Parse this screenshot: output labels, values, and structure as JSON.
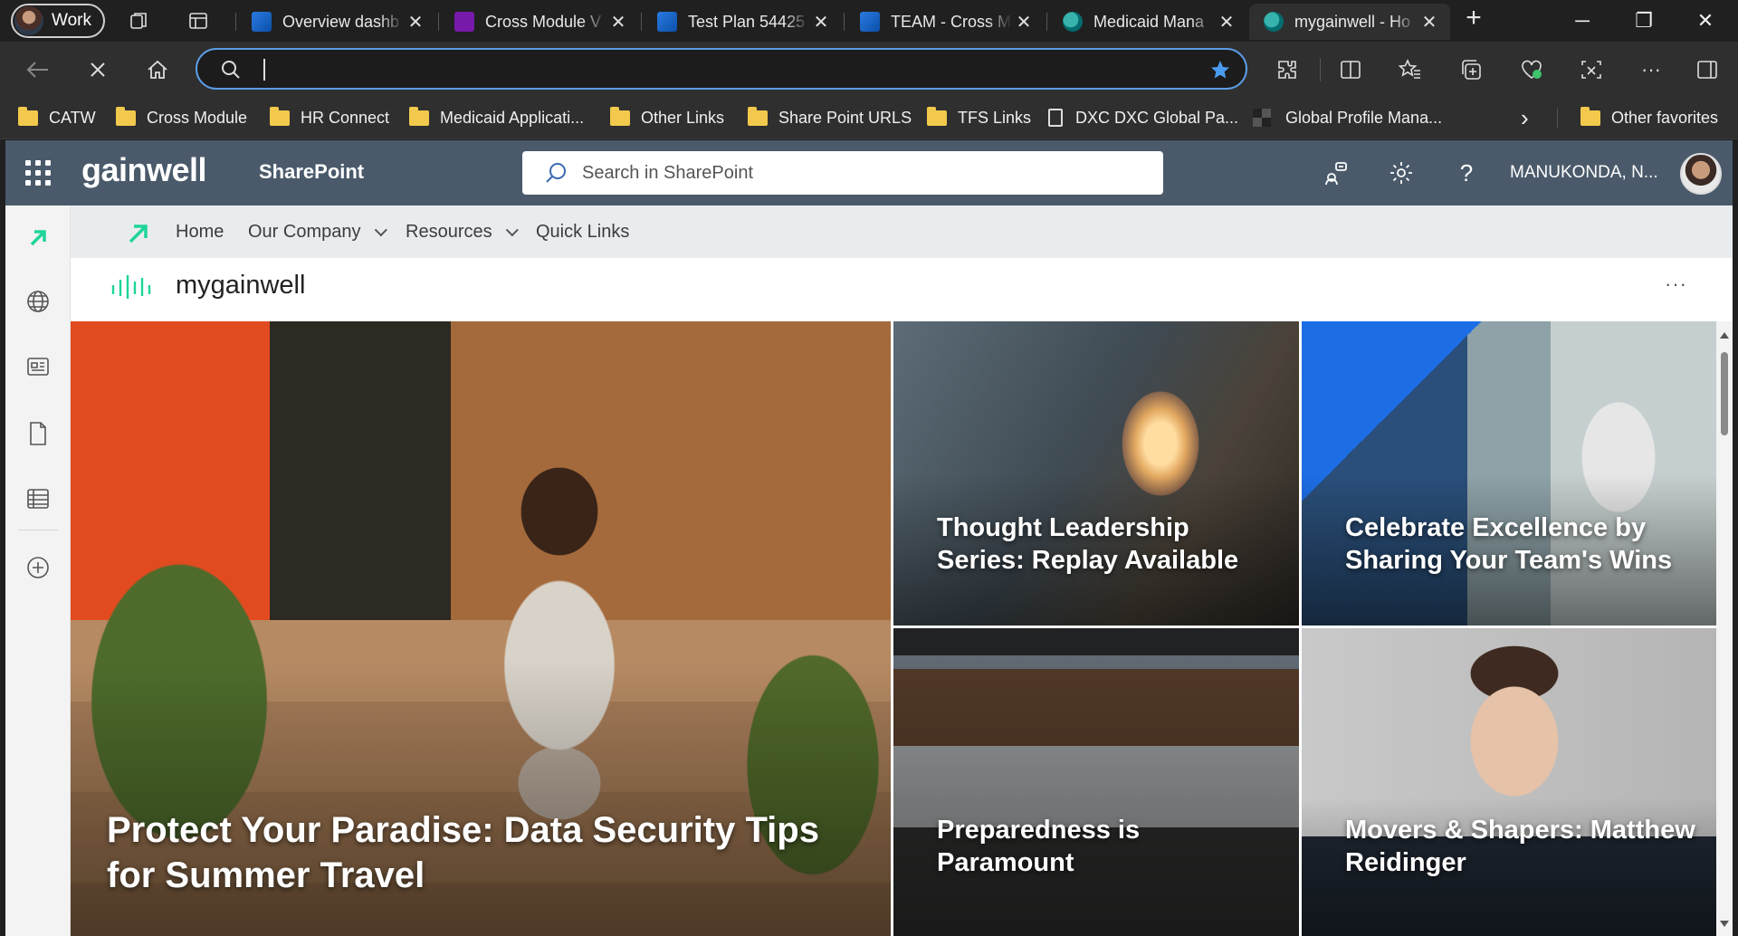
{
  "browser": {
    "profile_label": "Work",
    "tabs": [
      {
        "title": "Overview dashb",
        "favicon": "azure-devops",
        "close": "✕"
      },
      {
        "title": "Cross Module V",
        "favicon": "onenote",
        "close": "✕"
      },
      {
        "title": "Test Plan 54425",
        "favicon": "azure-devops",
        "close": "✕"
      },
      {
        "title": "TEAM - Cross M",
        "favicon": "azure-devops",
        "close": "✕"
      },
      {
        "title": "Medicaid Mana",
        "favicon": "sharepoint",
        "close": "✕"
      },
      {
        "title": "mygainwell - Ho",
        "favicon": "sharepoint",
        "close": "✕",
        "active": true
      }
    ],
    "new_tab": "+",
    "window_controls": {
      "minimize": "─",
      "restore": "❐",
      "close": "✕"
    },
    "address": {
      "value": "",
      "placeholder": ""
    },
    "favorites": [
      {
        "label": "CATW",
        "icon": "folder"
      },
      {
        "label": "Cross Module",
        "icon": "folder"
      },
      {
        "label": "HR Connect",
        "icon": "folder"
      },
      {
        "label": "Medicaid Applicati...",
        "icon": "folder"
      },
      {
        "label": "Other Links",
        "icon": "folder"
      },
      {
        "label": "Share Point URLS",
        "icon": "folder"
      },
      {
        "label": "TFS Links",
        "icon": "folder"
      },
      {
        "label": "DXC DXC Global Pa...",
        "icon": "page"
      },
      {
        "label": "Global Profile Mana...",
        "icon": "app"
      },
      {
        "label": "Other favorites",
        "icon": "folder"
      }
    ],
    "favorites_overflow": "›"
  },
  "sharepoint": {
    "logo_text": "gainwell",
    "app_name": "SharePoint",
    "search_placeholder": "Search in SharePoint",
    "help": "?",
    "user_name": "MANUKONDA, N...",
    "hub_nav": [
      {
        "label": "Home",
        "dropdown": false
      },
      {
        "label": "Our Company",
        "dropdown": true
      },
      {
        "label": "Resources",
        "dropdown": true
      },
      {
        "label": "Quick Links",
        "dropdown": false
      }
    ],
    "site_title": "mygainwell",
    "site_more": "···",
    "accent_color": "#1fd49a",
    "suite_color": "#4a5a6b"
  },
  "hero": {
    "main": "Protect Your Paradise: Data Security Tips for Summer Travel",
    "tile1": "Thought Leadership Series: Replay Available",
    "tile2": "Celebrate Excellence by Sharing Your Team's Wins",
    "tile3": "Preparedness is Paramount",
    "tile4": "Movers & Shapers: Matthew Reidinger"
  }
}
